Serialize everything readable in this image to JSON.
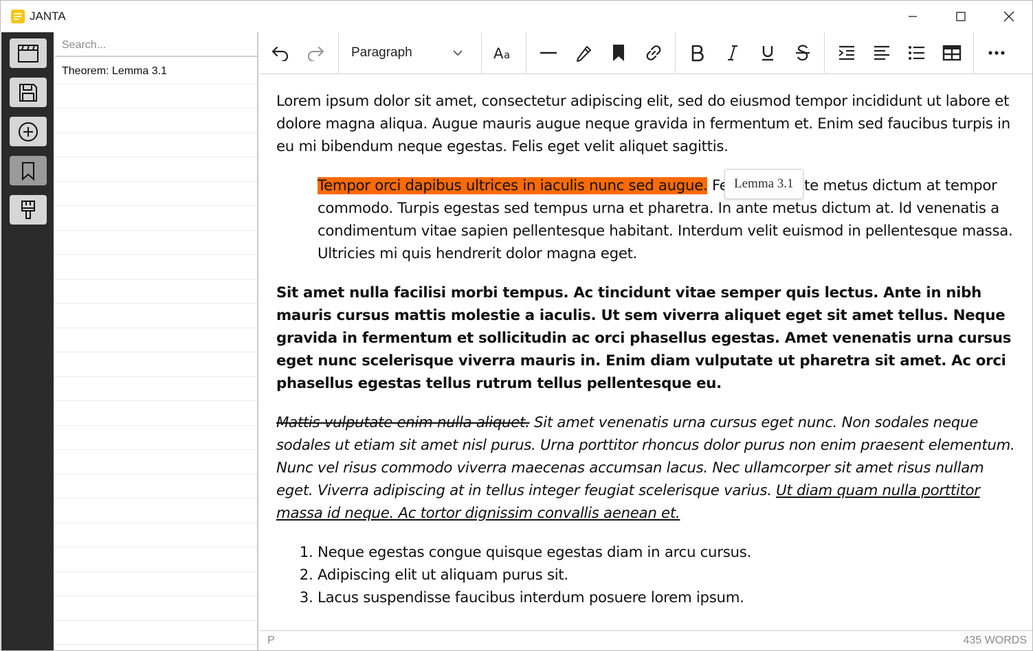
{
  "window": {
    "title": "JANTA",
    "minimize_icon": "minimize-icon",
    "maximize_icon": "maximize-icon",
    "close_icon": "close-icon"
  },
  "rail": {
    "items": [
      {
        "name": "open-notes",
        "icon": "clapperboard-icon"
      },
      {
        "name": "save",
        "icon": "floppy-disk-icon"
      },
      {
        "name": "new-note",
        "icon": "plus-circle-icon"
      },
      {
        "name": "bookmarks",
        "icon": "bookmark-icon",
        "active": true
      },
      {
        "name": "theme",
        "icon": "paintbrush-icon"
      }
    ]
  },
  "notes": {
    "search_placeholder": "Search...",
    "items": [
      "Theorem: Lemma 3.1"
    ]
  },
  "toolbar": {
    "block_format": "Paragraph",
    "icons": [
      "undo-icon",
      "redo-icon",
      "chevron-down-icon",
      "font-size-icon",
      "horizontal-rule-icon",
      "highlighter-icon",
      "bookmark-icon",
      "link-icon",
      "bold-icon",
      "italic-icon",
      "underline-icon",
      "strikethrough-icon",
      "indent-icon",
      "align-left-icon",
      "bullet-list-icon",
      "table-icon",
      "more-icon"
    ]
  },
  "editor": {
    "para1": "Lorem ipsum dolor sit amet, consectetur adipiscing elit, sed do eiusmod tempor incididunt ut labore et dolore magna aliqua. Augue mauris augue neque gravida in fermentum et. Enim sed faucibus turpis in eu mi bibendum neque egestas. Felis eget velit aliquet sagittis.",
    "quote_highlight": "Tempor orci dapibus ultrices in iaculis nunc sed augue.",
    "quote_rest": " Feugiat in ante metus dictum at tempor commodo. Turpis egestas sed tempus urna et pharetra. In ante metus dictum at. Id venenatis a condimentum vitae sapien pellentesque habitant. Interdum velit euismod in pellentesque massa. Ultricies mi quis hendrerit dolor magna eget.",
    "tooltip": "Lemma 3.1",
    "bold_para": "Sit amet nulla facilisi morbi tempus. Ac tincidunt vitae semper quis lectus. Ante in nibh mauris cursus mattis molestie a iaculis. Ut sem viverra aliquet eget sit amet tellus. Neque gravida in fermentum et sollicitudin ac orci phasellus egestas. Amet venenatis urna cursus eget nunc scelerisque viverra mauris in. Enim diam vulputate ut pharetra sit amet. Ac orci phasellus egestas tellus rutrum tellus pellentesque eu.",
    "italic_strike": "Mattis vulputate enim nulla aliquet.",
    "italic_mid": " Sit amet venenatis urna cursus eget nunc. Non sodales neque sodales ut etiam sit amet nisl purus. Urna porttitor rhoncus dolor purus non enim praesent elementum. Nunc vel risus commodo viverra maecenas accumsan lacus. Nec ullamcorper sit amet risus nullam eget. Viverra adipiscing at in tellus integer feugiat scelerisque varius. ",
    "italic_under": "Ut diam quam nulla porttitor massa id neque. Ac tortor dignissim convallis aenean et.",
    "list": [
      "Neque egestas congue quisque egestas diam in arcu cursus.",
      "Adipiscing elit ut aliquam purus sit.",
      "Lacus suspendisse faucibus interdum posuere lorem ipsum."
    ]
  },
  "status": {
    "path": "P",
    "word_count": "435 WORDS"
  },
  "colors": {
    "rail_bg": "#2a2a2a",
    "highlight": "#ff6a00",
    "logo": "#f5c518"
  }
}
